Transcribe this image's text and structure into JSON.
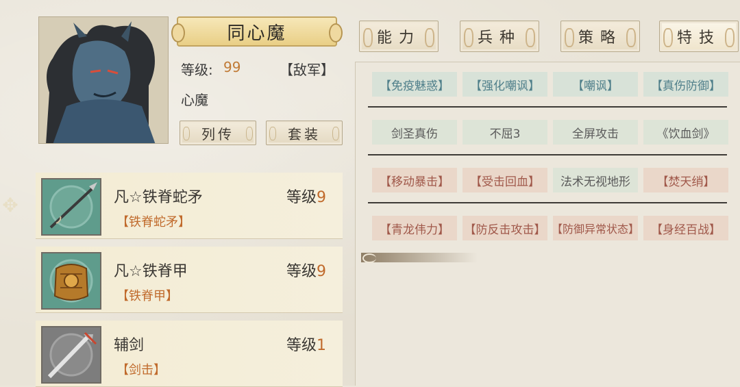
{
  "character": {
    "name": "同心魔",
    "level_label": "等级:",
    "level_value": "99",
    "faction": "【敌军】",
    "type": "心魔"
  },
  "buttons": {
    "biography": "列传",
    "set": "套装"
  },
  "tabs": [
    {
      "label": "能力",
      "active": false
    },
    {
      "label": "兵种",
      "active": false
    },
    {
      "label": "策略",
      "active": false
    },
    {
      "label": "特技",
      "active": true
    }
  ],
  "skills": [
    [
      {
        "label": "【免疫魅惑】",
        "color": "#4f7f8a"
      },
      {
        "label": "【强化嘲讽】",
        "color": "#4f7f8a"
      },
      {
        "label": "【嘲讽】",
        "color": "#4f7f8a"
      },
      {
        "label": "【真伤防御】",
        "color": "#4f7f8a"
      }
    ],
    [
      {
        "label": "剑圣真伤",
        "color": "#5a5a5a"
      },
      {
        "label": "不屈3",
        "color": "#5a5a5a"
      },
      {
        "label": "全屏攻击",
        "color": "#5a5a5a"
      },
      {
        "label": "《饮血剑》",
        "color": "#5a5a5a"
      }
    ],
    [
      {
        "label": "【移动暴击】",
        "color": "#a0584a"
      },
      {
        "label": "【受击回血】",
        "color": "#a0584a"
      },
      {
        "label": "法术无视地形",
        "color": "#5a5a5a"
      },
      {
        "label": "【焚天绡】",
        "color": "#a0584a"
      }
    ],
    [
      {
        "label": "【青龙伟力】",
        "color": "#a0584a"
      },
      {
        "label": "【防反击攻击】",
        "color": "#a0584a"
      },
      {
        "label": "【防御异常状态】",
        "color": "#a0584a"
      },
      {
        "label": "【身经百战】",
        "color": "#a0584a"
      }
    ]
  ],
  "equipment": [
    {
      "name": "凡☆铁脊蛇矛",
      "level_label": "等级",
      "level": "9",
      "tag": "【铁脊蛇矛】",
      "icon": "spear-icon"
    },
    {
      "name": "凡☆铁脊甲",
      "level_label": "等级",
      "level": "9",
      "tag": "【铁脊甲】",
      "icon": "armor-icon"
    },
    {
      "name": "辅剑",
      "level_label": "等级",
      "level": "1",
      "tag": "【剑击】",
      "icon": "sword-icon"
    }
  ],
  "colors": {
    "accent_orange": "#c07a35",
    "skill_teal_bg": "#d8e2d8",
    "skill_red_bg": "#ead7c9",
    "skill_neutral_bg": "#dde4d7"
  }
}
